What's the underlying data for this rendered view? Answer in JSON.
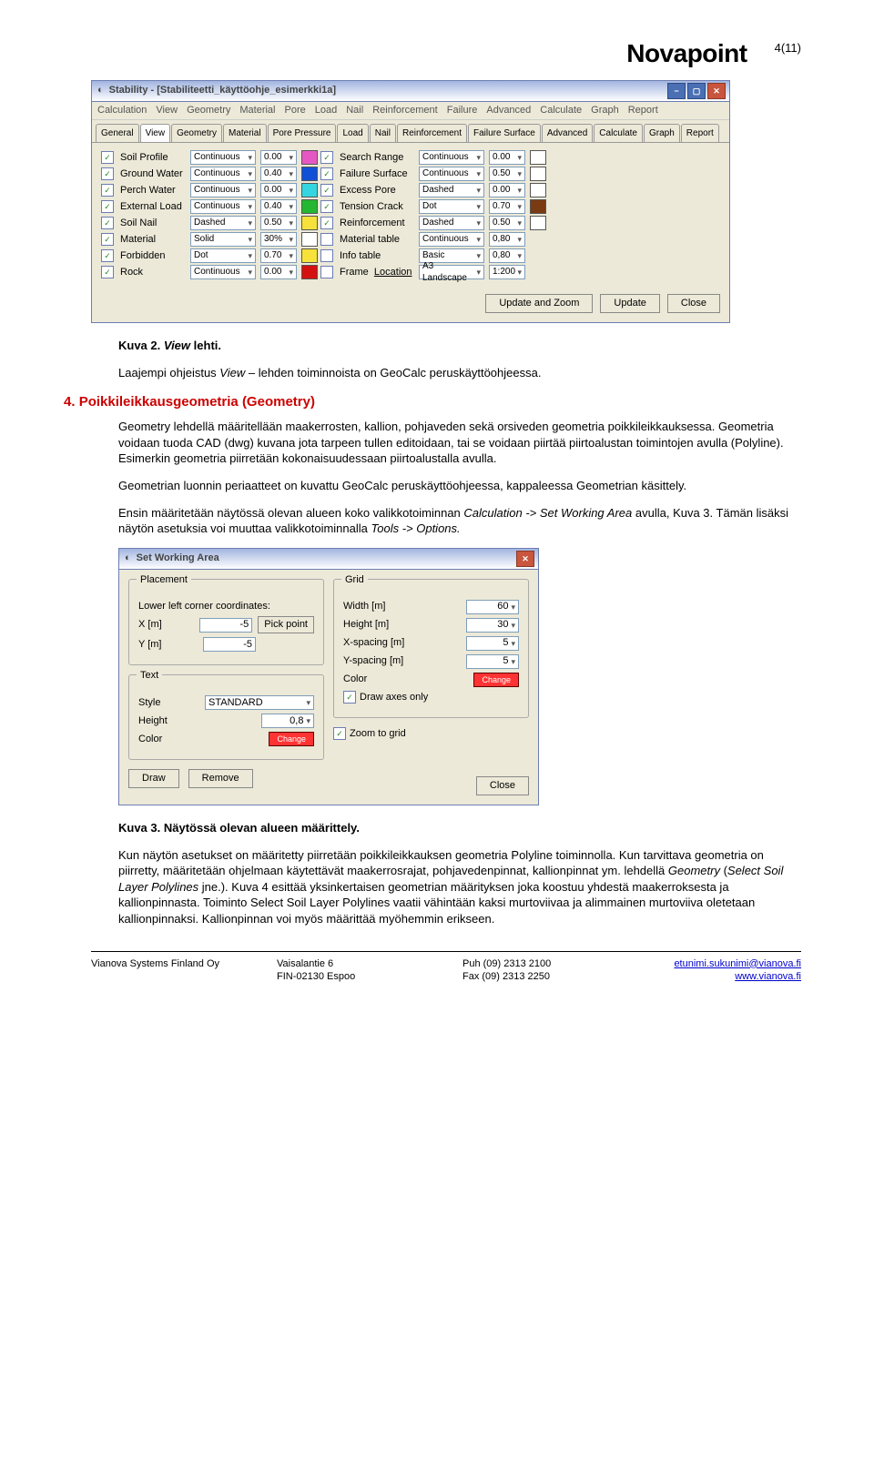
{
  "header": {
    "brand": "Novapoint",
    "pagenum": "4(11)"
  },
  "stability_window": {
    "title": "Stability - [Stabiliteetti_käyttöohje_esimerkki1a]",
    "menu": [
      "Calculation",
      "View",
      "Geometry",
      "Material",
      "Pore",
      "Load",
      "Nail",
      "Reinforcement",
      "Failure",
      "Advanced",
      "Calculate",
      "Graph",
      "Report"
    ],
    "tabs": [
      "General",
      "View",
      "Geometry",
      "Material",
      "Pore Pressure",
      "Load",
      "Nail",
      "Reinforcement",
      "Failure Surface",
      "Advanced",
      "Calculate",
      "Graph",
      "Report"
    ],
    "active_tab": "View",
    "left_rows": [
      {
        "label": "Soil Profile",
        "style": "Continuous",
        "val": "0.00",
        "color": "#e558c3",
        "checked": true
      },
      {
        "label": "Ground Water",
        "style": "Continuous",
        "val": "0.40",
        "color": "#1050d6",
        "checked": true
      },
      {
        "label": "Perch Water",
        "style": "Continuous",
        "val": "0.00",
        "color": "#33d6e0",
        "checked": true
      },
      {
        "label": "External Load",
        "style": "Continuous",
        "val": "0.40",
        "color": "#24b832",
        "checked": true
      },
      {
        "label": "Soil Nail",
        "style": "Dashed",
        "val": "0.50",
        "color": "#f6e23a",
        "checked": true
      },
      {
        "label": "Material",
        "style": "Solid",
        "val": "30%",
        "color": "#ffffff",
        "checked": true
      },
      {
        "label": "Forbidden",
        "style": "Dot",
        "val": "0.70",
        "color": "#f6e23a",
        "checked": true
      },
      {
        "label": "Rock",
        "style": "Continuous",
        "val": "0.00",
        "color": "#d31111",
        "checked": true
      }
    ],
    "right_rows": [
      {
        "label": "Search Range",
        "style": "Continuous",
        "val": "0.00",
        "color": "#ffffff",
        "checked": true
      },
      {
        "label": "Failure Surface",
        "style": "Continuous",
        "val": "0.50",
        "color": "#ffffff",
        "checked": true
      },
      {
        "label": "Excess Pore",
        "style": "Dashed",
        "val": "0.00",
        "color": "#ffffff",
        "checked": true
      },
      {
        "label": "Tension Crack",
        "style": "Dot",
        "val": "0.70",
        "color": "#7a3b13",
        "checked": true
      },
      {
        "label": "Reinforcement",
        "style": "Dashed",
        "val": "0.50",
        "color": "#ffffff",
        "checked": true
      },
      {
        "label": "Material table",
        "style": "Continuous",
        "val": "0,80",
        "color": "",
        "checked": false
      },
      {
        "label": "Info table",
        "style": "Basic",
        "val": "0,80",
        "color": "",
        "checked": false
      },
      {
        "label": "Frame",
        "label2": "Location",
        "style": "A3 Landscape",
        "val": "1:200",
        "color": "",
        "checked": false
      }
    ],
    "buttons": [
      "Update and Zoom",
      "Update",
      "Close"
    ]
  },
  "swa_window": {
    "title": "Set Working Area",
    "placement_legend": "Placement",
    "placement_label": "Lower left corner coordinates:",
    "xm_label": "X [m]",
    "xm_val": "-5",
    "ym_label": "Y [m]",
    "ym_val": "-5",
    "pick_point": "Pick point",
    "text_legend": "Text",
    "style_label": "Style",
    "style_val": "STANDARD",
    "height_label": "Height",
    "height_val": "0,8",
    "color_label": "Color",
    "color_btn": "Change",
    "grid_legend": "Grid",
    "width_label": "Width [m]",
    "width_val": "60",
    "heightm_label": "Height [m]",
    "heightm_val": "30",
    "xsp_label": "X-spacing [m]",
    "xsp_val": "5",
    "ysp_label": "Y-spacing [m]",
    "ysp_val": "5",
    "gcolor_label": "Color",
    "gcolor_btn": "Change",
    "draw_axes": "Draw axes only",
    "zoom_grid": "Zoom to grid",
    "btn_draw": "Draw",
    "btn_remove": "Remove",
    "btn_close": "Close"
  },
  "doc": {
    "kuva2_caption_a": "Kuva 2.",
    "kuva2_caption_b": "View",
    "kuva2_caption_c": "lehti.",
    "p1_a": "Laajempi ohjeistus ",
    "p1_b": "View",
    "p1_c": " – lehden toiminnoista on GeoCalc peruskäyttöohjeessa.",
    "h2": "4. Poikkileikkausgeometria (Geometry)",
    "p2": "Geometry lehdellä määritellään maakerrosten, kallion, pohjaveden sekä orsiveden geometria poikkileikkauksessa. Geometria voidaan tuoda CAD (dwg) kuvana jota tarpeen tullen editoidaan, tai se voidaan piirtää piirtoalustan toimintojen avulla (Polyline). Esimerkin geometria piirretään kokonaisuudessaan piirtoalustalla avulla.",
    "p3": "Geometrian luonnin periaatteet on kuvattu GeoCalc peruskäyttöohjeessa, kappaleessa Geometrian käsittely.",
    "p4_a": "Ensin määritetään näytössä olevan alueen koko valikkotoiminnan ",
    "p4_b": "Calculation -> Set Working Area",
    "p4_c": " avulla, Kuva 3. Tämän lisäksi näytön asetuksia voi muuttaa valikkotoiminnalla ",
    "p4_d": "Tools -> Options.",
    "kuva3": "Kuva 3. Näytössä olevan alueen määrittely.",
    "p5_a": "Kun näytön asetukset on määritetty piirretään poikkileikkauksen geometria Polyline toiminnolla. Kun tarvittava geometria on piirretty, määritetään ohjelmaan käytettävät maakerrosrajat, pohjavedenpinnat, kallionpinnat ym. lehdellä ",
    "p5_b": "Geometry",
    "p5_c": " (",
    "p5_d": "Select Soil Layer Polylines",
    "p5_e": " jne.). Kuva 4 esittää yksinkertaisen geometrian määrityksen joka koostuu yhdestä maakerroksesta ja kallionpinnasta. Toiminto Select Soil Layer Polylines vaatii vähintään kaksi murtoviivaa ja alimmainen murtoviiva oletetaan kallionpinnaksi. Kallionpinnan voi myös määrittää myöhemmin erikseen."
  },
  "footer": {
    "c1a": "Vianova Systems Finland Oy",
    "c2a": "Vaisalantie 6",
    "c2b": "FIN-02130 Espoo",
    "c3a": "Puh  (09) 2313 2100",
    "c3b": "Fax  (09) 2313 2250",
    "c4a": "etunimi.sukunimi@vianova.fi",
    "c4b": "www.vianova.fi"
  }
}
